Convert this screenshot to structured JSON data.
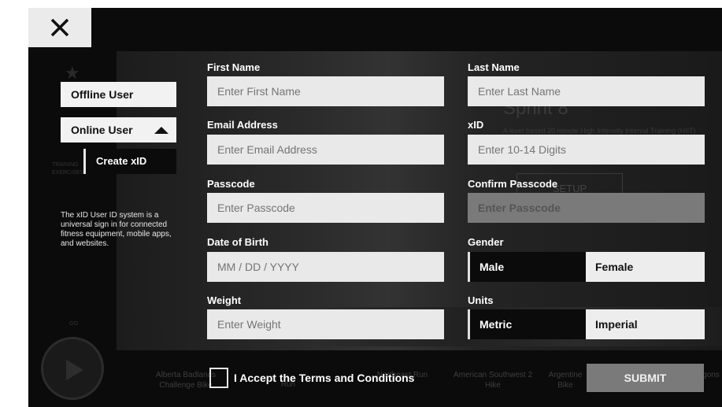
{
  "close": {
    "icon": "close-icon"
  },
  "background": {
    "workout_title": "Sprint 8",
    "workout_desc": "A level based 20 minute High Intensity Interval Training (HIIT)",
    "setup_label": "SETUP",
    "nav_training": "TRAINING",
    "nav_exercises": "EXERCISES",
    "nav_go": "GO",
    "captions": [
      "Alberta Badlands Challenge Bike",
      "Run",
      "Northeast Run",
      "American Southwest 2 Hike",
      "Argentine Bike",
      "gons"
    ]
  },
  "sidebar": {
    "offline_label": "Offline User",
    "online_label": "Online User",
    "create_xid_label": "Create xID",
    "xid_info": "The xID User ID system is a universal sign in for connected fitness equipment, mobile apps, and websites."
  },
  "form": {
    "first_name": {
      "label": "First Name",
      "placeholder": "Enter First Name"
    },
    "last_name": {
      "label": "Last Name",
      "placeholder": "Enter Last Name"
    },
    "email": {
      "label": "Email Address",
      "placeholder": "Enter Email Address"
    },
    "xid": {
      "label": "xID",
      "placeholder": "Enter 10-14 Digits"
    },
    "passcode": {
      "label": "Passcode",
      "placeholder": "Enter Passcode"
    },
    "confirm_passcode": {
      "label": "Confirm Passcode",
      "placeholder": "Enter Passcode"
    },
    "dob": {
      "label": "Date of Birth",
      "placeholder": "MM / DD / YYYY"
    },
    "gender": {
      "label": "Gender",
      "options": [
        "Male",
        "Female"
      ],
      "selected": "Male"
    },
    "weight": {
      "label": "Weight",
      "placeholder": "Enter Weight"
    },
    "units": {
      "label": "Units",
      "options": [
        "Metric",
        "Imperial"
      ],
      "selected": "Metric"
    },
    "terms_label": "I Accept the Terms and Conditions",
    "submit_label": "SUBMIT"
  }
}
